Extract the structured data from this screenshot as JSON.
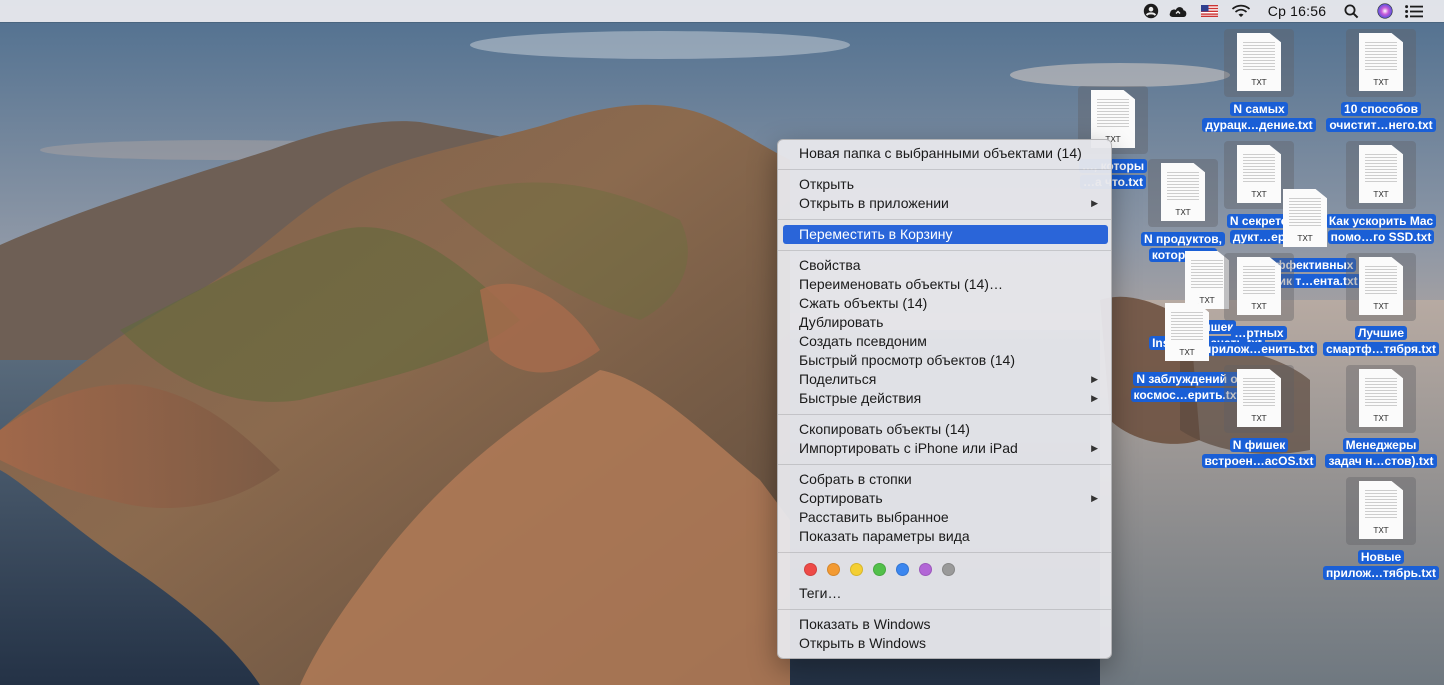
{
  "menubar": {
    "clock": "Ср 16:56",
    "icons": [
      "user-icon",
      "cloud-icon",
      "us-flag-icon",
      "wifi-icon",
      "spotlight-icon",
      "siri-icon",
      "notification-center-icon"
    ]
  },
  "context_menu": {
    "new_folder": "Новая папка с выбранными объектами (14)",
    "open": "Открыть",
    "open_with": "Открыть в приложении",
    "move_to_trash": "Переместить в Корзину",
    "get_info": "Свойства",
    "rename": "Переименовать объекты (14)…",
    "compress": "Сжать объекты (14)",
    "duplicate": "Дублировать",
    "make_alias": "Создать псевдоним",
    "quick_look": "Быстрый просмотр объектов (14)",
    "share": "Поделиться",
    "quick_actions": "Быстрые действия",
    "copy": "Скопировать объекты (14)",
    "import_iphone": "Импортировать с iPhone или iPad",
    "use_stacks": "Собрать в стопки",
    "sort_by": "Сортировать",
    "clean_up": "Расставить выбранное",
    "view_options": "Показать параметры вида",
    "tags": "Теги…",
    "show_in_windows": "Показать в Windows",
    "open_in_windows": "Открыть в Windows",
    "tag_colors": [
      "#ee4a47",
      "#f39a32",
      "#f4cf33",
      "#52c04a",
      "#3b86ef",
      "#b266d6",
      "#9a9a9a"
    ]
  },
  "desktop_files": [
    {
      "line1": "N самых",
      "line2": "дурацк…дение.txt"
    },
    {
      "line1": "10 способов",
      "line2": "очистит…него.txt"
    },
    {
      "line1": "…, которы",
      "line2": "…а что.txt"
    },
    {
      "line1": "N секрето",
      "line2": "дукт…ер"
    },
    {
      "line1": "Как ускорить Mac",
      "line2": "помо…го SSD.txt"
    },
    {
      "line1": "N продуктов,",
      "line2": "которые…"
    },
    {
      "line1": "N эффективных",
      "line2": "техник т…ента.txt"
    },
    {
      "line1": "N фишек",
      "line2": "Instagra…знать.txt"
    },
    {
      "line1": "…ртных",
      "line2": "прилож…енить.txt"
    },
    {
      "line1": "Лучшие",
      "line2": "смартф…тября.txt"
    },
    {
      "line1": "N заблуждений о",
      "line2": "космос…ерить.txt"
    },
    {
      "line1": "N фишек",
      "line2": "встроен…acOS.txt"
    },
    {
      "line1": "Менеджеры",
      "line2": "задач н…стов).txt"
    },
    {
      "line1": "Новые",
      "line2": "прилож…тябрь.txt"
    }
  ],
  "file_ext": "TXT",
  "colors": {
    "selection_blue": "#2a65d9",
    "label_blue": "#1a5fd6"
  }
}
